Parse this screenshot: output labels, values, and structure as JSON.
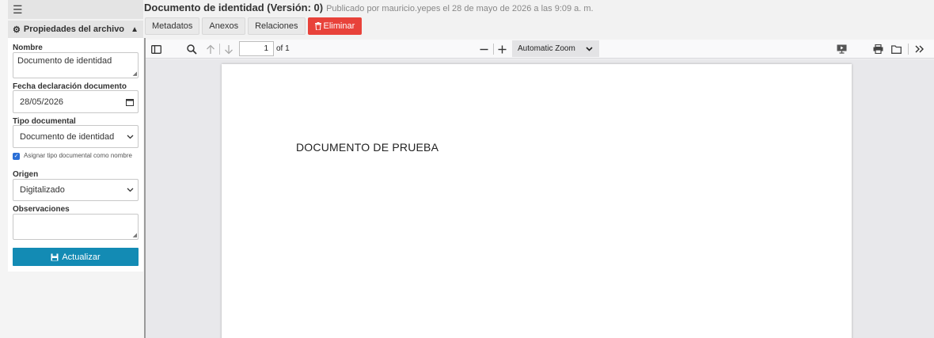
{
  "sidebar": {
    "menu_icon": "hamburger-icon",
    "panel_title": "Propiedades del archivo",
    "fields": {
      "nombre": {
        "label": "Nombre",
        "value": "Documento de identidad"
      },
      "fecha": {
        "label": "Fecha declaración documento",
        "value": "28/05/2026"
      },
      "tipo": {
        "label": "Tipo documental",
        "value": "Documento de identidad"
      },
      "asignar": {
        "label": "Asignar tipo documental como nombre",
        "checked": true
      },
      "origen": {
        "label": "Origen",
        "value": "Digitalizado"
      },
      "observaciones": {
        "label": "Observaciones",
        "value": ""
      }
    },
    "update_button": "Actualizar"
  },
  "header": {
    "title": "Documento de identidad (Versión: 0)",
    "subtitle": "Publicado por mauricio.yepes el 28 de mayo de 2026 a las 9:09 a. m."
  },
  "tabs": [
    {
      "label": "Metadatos"
    },
    {
      "label": "Anexos"
    },
    {
      "label": "Relaciones"
    },
    {
      "label": "Eliminar"
    }
  ],
  "pdf_viewer": {
    "page_number": "1",
    "page_total": "of 1",
    "zoom": "Automatic Zoom",
    "page_text": "DOCUMENTO DE PRUEBA"
  },
  "colors": {
    "update_button": "#138bb4",
    "delete_tab": "#e8423a",
    "checkbox": "#2a6fd6"
  }
}
